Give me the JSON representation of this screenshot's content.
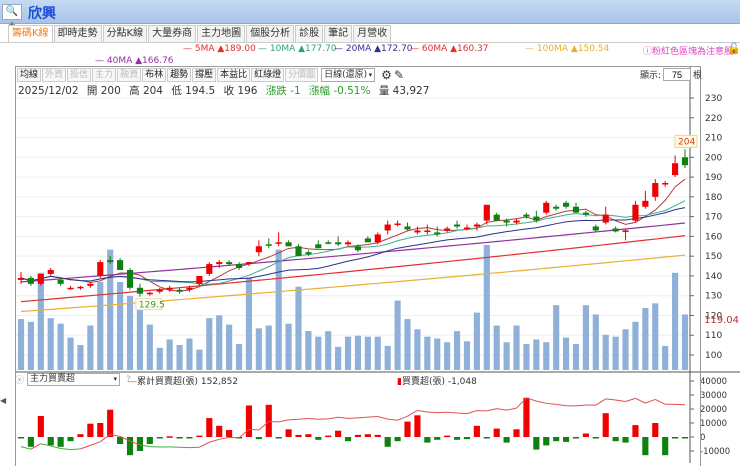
{
  "header": {
    "title": "欣興",
    "search_icon": "magnifier-plus"
  },
  "tabs": [
    {
      "label": "籌碼K線",
      "active": true
    },
    {
      "label": "即時走勢"
    },
    {
      "label": "分點K線"
    },
    {
      "label": "大量券商"
    },
    {
      "label": "主力地圖"
    },
    {
      "label": "個股分析"
    },
    {
      "label": "診股"
    },
    {
      "label": "筆記"
    },
    {
      "label": "月營收"
    }
  ],
  "ma_legend": [
    {
      "label": "5MA ▲189.00",
      "color": "#e03030"
    },
    {
      "label": "10MA ▲177.70",
      "color": "#30a080"
    },
    {
      "label": "20MA ▲172.70",
      "color": "#303090"
    },
    {
      "label": "60MA ▲160.37",
      "color": "#e03030"
    },
    {
      "label": "100MA ▲150.54",
      "color": "#e8b030"
    },
    {
      "label": "40MA ▲166.76",
      "color": "#9030a0"
    }
  ],
  "note": "ⓘ粉紅色區塊為注意股",
  "toolbar": {
    "buttons": [
      {
        "label": "均線"
      },
      {
        "label": "外資",
        "disabled": true
      },
      {
        "label": "投信",
        "disabled": true
      },
      {
        "label": "主力",
        "disabled": true
      },
      {
        "label": "融資",
        "disabled": true
      },
      {
        "label": "布林"
      },
      {
        "label": "趨勢"
      },
      {
        "label": "撐壓"
      },
      {
        "label": "本益比"
      },
      {
        "label": "紅綠燈"
      },
      {
        "label": "分價圖",
        "disabled": true
      }
    ],
    "period": "日線(還原)",
    "show_label": "顯示:",
    "show_value": "75",
    "show_unit": "根"
  },
  "info": {
    "date": "2025/12/02",
    "open": "開 200",
    "high": "高 204",
    "low": "低 194.5",
    "close": "收 196",
    "change": "漲跌 -1",
    "pct": "漲幅 -0.51%",
    "volume": "量 43,927"
  },
  "lower": {
    "indicator": "主力買賣超",
    "help": "?",
    "cum_label": "累計買賣超(張) 152,852",
    "bar_label": "買賣超(張) -1,048"
  },
  "chart_data": {
    "type": "candlestick",
    "y_ticks": [
      "230",
      "220",
      "210",
      "200",
      "190",
      "180",
      "170",
      "160",
      "150",
      "140",
      "130",
      "120",
      "110",
      "100"
    ],
    "y_range": [
      100,
      230
    ],
    "high_label": "204",
    "low_label": "129.5",
    "volume_axis_label": "119.04",
    "low_ticks": [
      "40000",
      "30000",
      "20000",
      "10000",
      "0",
      "-10000"
    ],
    "low_range": [
      -10000,
      40000
    ],
    "ohlc": [
      [
        138,
        142,
        136,
        139
      ],
      [
        139,
        140,
        135,
        136
      ],
      [
        136,
        141,
        135,
        141
      ],
      [
        141,
        144,
        140,
        143
      ],
      [
        138,
        139,
        135,
        136
      ],
      [
        134,
        135,
        133,
        134
      ],
      [
        134,
        135,
        133,
        134.5
      ],
      [
        135,
        137,
        134,
        136
      ],
      [
        140,
        148,
        139,
        147
      ],
      [
        148,
        150,
        146,
        147
      ],
      [
        148,
        149,
        143,
        143
      ],
      [
        143,
        144,
        133,
        134
      ],
      [
        134,
        136,
        129.5,
        131
      ],
      [
        131,
        132,
        130,
        131.5
      ],
      [
        132,
        134,
        131,
        133
      ],
      [
        133,
        135,
        132,
        134
      ],
      [
        133,
        134,
        131,
        132
      ],
      [
        133,
        135,
        132,
        134
      ],
      [
        136,
        140,
        135,
        140
      ],
      [
        141,
        147,
        140,
        146
      ],
      [
        146,
        148,
        144,
        147
      ],
      [
        147,
        148,
        145,
        146
      ],
      [
        146,
        147,
        143,
        144
      ],
      [
        146,
        147,
        145,
        147
      ],
      [
        152,
        158,
        150,
        155
      ],
      [
        156,
        159,
        154,
        155.5
      ],
      [
        157,
        162,
        155,
        157
      ],
      [
        157,
        158,
        155,
        155
      ],
      [
        155,
        156,
        150,
        150
      ],
      [
        152,
        153,
        150,
        151
      ],
      [
        156,
        158,
        154,
        154
      ],
      [
        157,
        158,
        156,
        156.5
      ],
      [
        157,
        160,
        155,
        156
      ],
      [
        156,
        158,
        155,
        157
      ],
      [
        155,
        156,
        152,
        153
      ],
      [
        159,
        160,
        157,
        157
      ],
      [
        157,
        162,
        156,
        161
      ],
      [
        163,
        168,
        161,
        166
      ],
      [
        166,
        168,
        165,
        166.5
      ],
      [
        165,
        167,
        163,
        163.5
      ],
      [
        162,
        165,
        161,
        163
      ],
      [
        163,
        166,
        161,
        163
      ],
      [
        162,
        165,
        160,
        161
      ],
      [
        163,
        165,
        162,
        164
      ],
      [
        166,
        168,
        164,
        165
      ],
      [
        164,
        166,
        163,
        164.5
      ],
      [
        165,
        167,
        163,
        166
      ],
      [
        168,
        175,
        166,
        176
      ],
      [
        171,
        172,
        168,
        168
      ],
      [
        168,
        169,
        165,
        167
      ],
      [
        167,
        169,
        166,
        168
      ],
      [
        171,
        172,
        169,
        170
      ],
      [
        170,
        173,
        167,
        168
      ],
      [
        172,
        178,
        171,
        177
      ],
      [
        175,
        176,
        173,
        174
      ],
      [
        177,
        178,
        174,
        175
      ],
      [
        175,
        177,
        172,
        172
      ],
      [
        172,
        173,
        170,
        171
      ],
      [
        165,
        166,
        162,
        163
      ],
      [
        167,
        175,
        166,
        171
      ],
      [
        164,
        165,
        162,
        162.5
      ],
      [
        163,
        164,
        158,
        163
      ],
      [
        168,
        178,
        167,
        176
      ],
      [
        175,
        183,
        174,
        178
      ],
      [
        180,
        189,
        178,
        187
      ],
      [
        187,
        188,
        185,
        187
      ],
      [
        191,
        201,
        190,
        197
      ],
      [
        200,
        204,
        194.5,
        196
      ]
    ],
    "volume": [
      5500,
      5200,
      10500,
      5600,
      5000,
      3500,
      2700,
      4800,
      9500,
      13000,
      9500,
      8000,
      7000,
      4900,
      2400,
      3300,
      2700,
      3400,
      2200,
      5600,
      5900,
      4900,
      2800,
      10000,
      4500,
      4800,
      13000,
      5000,
      9000,
      4200,
      3600,
      4200,
      2500,
      3600,
      3700,
      3600,
      3600,
      2600,
      7500,
      5500,
      4400,
      3600,
      3400,
      3000,
      4200,
      3100,
      6200,
      13500,
      4800,
      3000,
      4800,
      2800,
      3300,
      3000,
      7000,
      3500,
      2800,
      7000,
      6000,
      3800,
      3600,
      4400,
      5200,
      6700,
      7200,
      2600,
      10500,
      6000
    ],
    "ma_long": [
      {
        "name": "40MA",
        "color": "#9030a0",
        "start": 137,
        "end": 166.76
      },
      {
        "name": "60MA",
        "color": "#e03030",
        "start": 127,
        "end": 160.37
      },
      {
        "name": "100MA",
        "color": "#e8b030",
        "start": 122,
        "end": 150.54
      }
    ],
    "ma_short": [
      {
        "name": "5MA",
        "n": 5,
        "color": "#b04040"
      },
      {
        "name": "10MA",
        "n": 10,
        "color": "#40b090"
      },
      {
        "name": "20MA",
        "n": 20,
        "color": "#303090"
      }
    ],
    "netbuy": [
      -1000,
      -7000,
      15000,
      -6000,
      -7000,
      -3000,
      2000,
      9500,
      10000,
      19500,
      -5000,
      -13000,
      -10000,
      -5000,
      -1000,
      500,
      -1000,
      -1000,
      1000,
      13500,
      8000,
      5000,
      -500,
      22500,
      -1500,
      23000,
      -1000,
      5500,
      1500,
      2000,
      -2000,
      1000,
      4500,
      -3000,
      1500,
      2000,
      1500,
      -7000,
      -3000,
      11000,
      15500,
      -4000,
      -2000,
      1000,
      -2000,
      -1500,
      8000,
      -500,
      6000,
      -4000,
      5500,
      28000,
      -9000,
      -6000,
      -3000,
      -3500,
      -500,
      2500,
      -500,
      17000,
      -3000,
      -4000,
      8500,
      -13000,
      10000,
      -13000,
      -500,
      -1048
    ],
    "cum_range": [
      -9000,
      28000
    ],
    "colors": {
      "up": "#f00000",
      "down": "#108010",
      "volume": "#8fb0d8"
    }
  }
}
